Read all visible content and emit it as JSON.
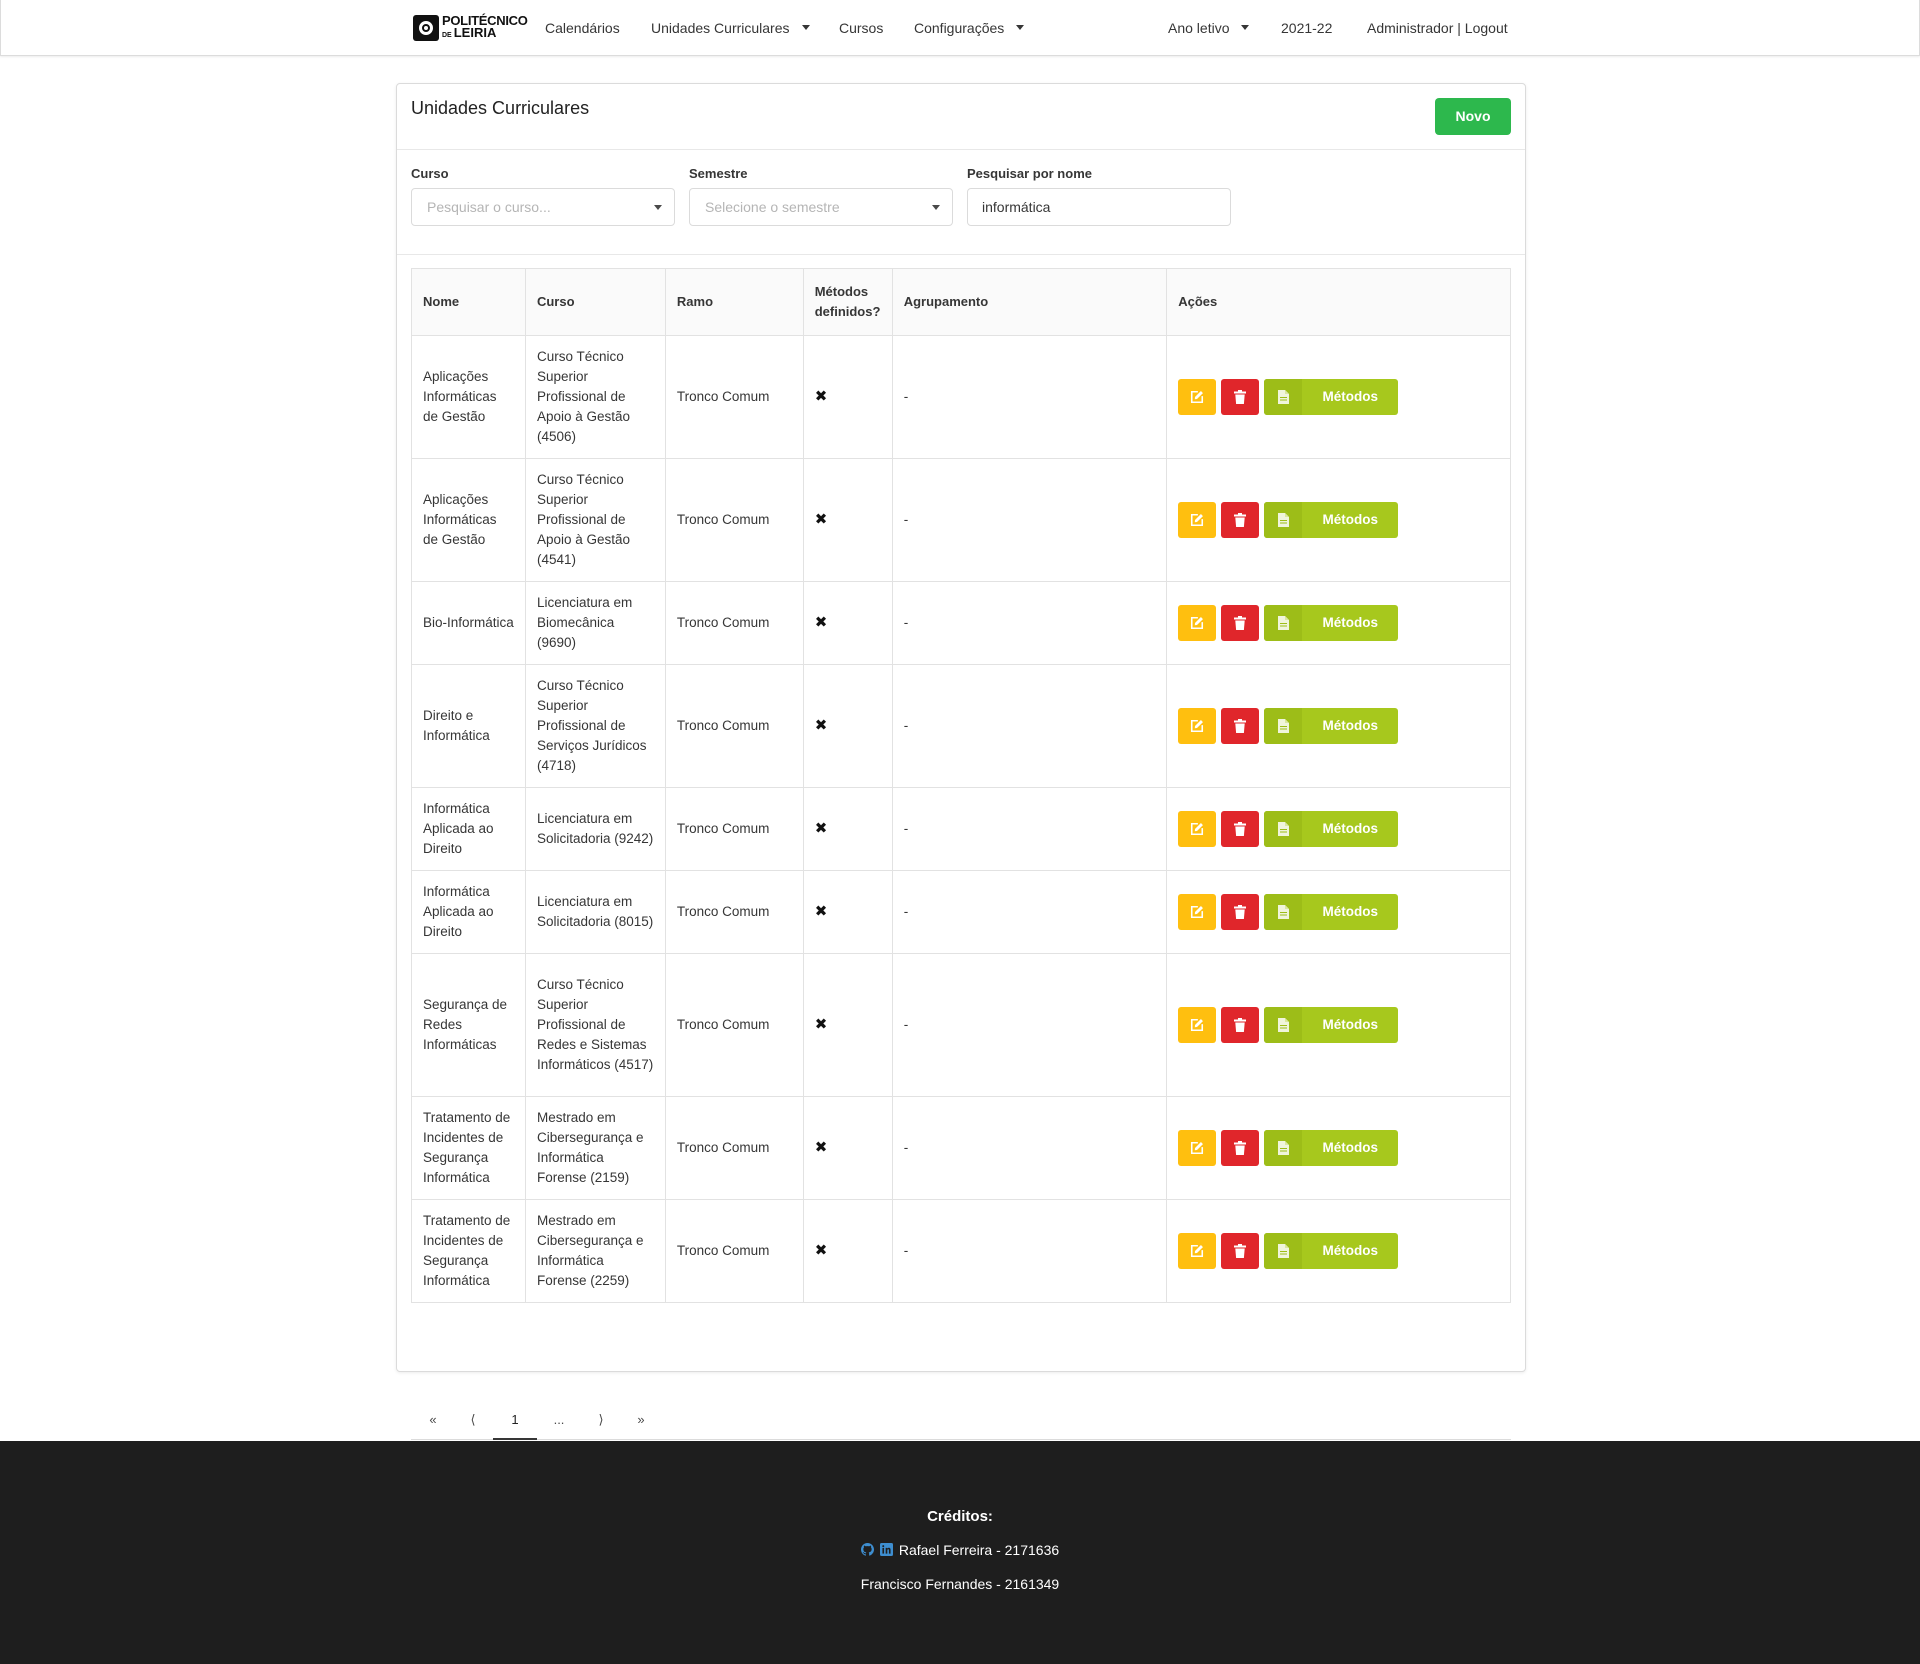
{
  "navbar": {
    "brand_line1": "POLITÉCNICO",
    "brand_line2_prefix": "DE",
    "brand_line2": "LEIRIA",
    "items": [
      {
        "label": "Calendários"
      },
      {
        "label": "Unidades Curriculares"
      },
      {
        "label": "Cursos"
      },
      {
        "label": "Configurações"
      }
    ],
    "year_menu": "Ano letivo",
    "year_value": "2021-22",
    "user": "Administrador",
    "separator": "|",
    "logout": "Logout"
  },
  "page": {
    "title": "Unidades Curriculares",
    "new_button": "Novo"
  },
  "filters": {
    "curso": {
      "label": "Curso",
      "placeholder": "Pesquisar o curso..."
    },
    "semestre": {
      "label": "Semestre",
      "placeholder": "Selecione o semestre"
    },
    "nome": {
      "label": "Pesquisar por nome",
      "value": "informática"
    }
  },
  "table": {
    "headers": [
      "Nome",
      "Curso",
      "Ramo",
      "Métodos definidos?",
      "Agrupamento",
      "Ações"
    ],
    "header_metodos_l1": "Métodos",
    "header_metodos_l2": "definidos?",
    "methods_button": "Métodos",
    "rows": [
      {
        "nome": "Aplicações Informáticas de Gestão",
        "curso": "Curso Técnico Superior Profissional de Apoio à Gestão (4506)",
        "ramo": "Tronco Comum",
        "metodos": "✖",
        "agrupamento": "-"
      },
      {
        "nome": "Aplicações Informáticas de Gestão",
        "curso": "Curso Técnico Superior Profissional de Apoio à Gestão (4541)",
        "ramo": "Tronco Comum",
        "metodos": "✖",
        "agrupamento": "-"
      },
      {
        "nome": "Bio-Informática",
        "curso": "Licenciatura em Biomecânica (9690)",
        "ramo": "Tronco Comum",
        "metodos": "✖",
        "agrupamento": "-"
      },
      {
        "nome": "Direito e Informática",
        "curso": "Curso Técnico Superior Profissional de Serviços Jurídicos (4718)",
        "ramo": "Tronco Comum",
        "metodos": "✖",
        "agrupamento": "-"
      },
      {
        "nome": "Informática Aplicada ao Direito",
        "curso": "Licenciatura em Solicitadoria (9242)",
        "ramo": "Tronco Comum",
        "metodos": "✖",
        "agrupamento": "-"
      },
      {
        "nome": "Informática Aplicada ao Direito",
        "curso": "Licenciatura em Solicitadoria (8015)",
        "ramo": "Tronco Comum",
        "metodos": "✖",
        "agrupamento": "-"
      },
      {
        "nome": "Segurança de Redes Informáticas",
        "curso": "Curso Técnico Superior Profissional de Redes e Sistemas Informáticos (4517)",
        "ramo": "Tronco Comum",
        "metodos": "✖",
        "agrupamento": "-"
      },
      {
        "nome": "Tratamento de Incidentes de Segurança Informática",
        "curso": "Mestrado em Cibersegurança e Informática Forense (2159)",
        "ramo": "Tronco Comum",
        "metodos": "✖",
        "agrupamento": "-"
      },
      {
        "nome": "Tratamento de Incidentes de Segurança Informática",
        "curso": "Mestrado em Cibersegurança e Informática Forense (2259)",
        "ramo": "Tronco Comum",
        "metodos": "✖",
        "agrupamento": "-"
      }
    ]
  },
  "pagination": {
    "first": "«",
    "prev": "⟨",
    "current": "1",
    "ellipsis": "...",
    "next": "⟩",
    "last": "»"
  },
  "footer": {
    "title": "Créditos:",
    "credit1": "Rafael Ferreira - 2171636",
    "credit2": "Francisco Fernandes - 2161349"
  },
  "colors": {
    "new_button": "#2db84d",
    "edit_button": "#ffbf0f",
    "delete_button": "#e0262b",
    "methods_button": "#a7c81d",
    "footer_bg": "#1e1e1e",
    "icon_blue": "#3e8ed0"
  },
  "icons": {
    "edit": "edit-icon",
    "delete": "trash-icon",
    "methods": "document-icon",
    "github": "github-icon",
    "linkedin": "linkedin-icon"
  }
}
